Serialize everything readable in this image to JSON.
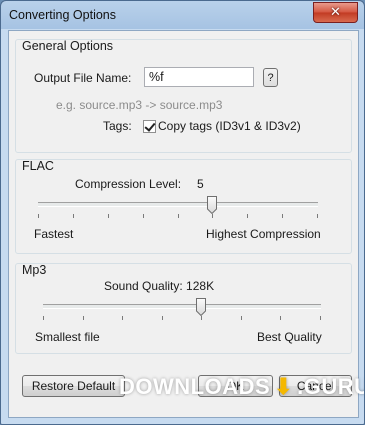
{
  "window": {
    "title": "Converting Options",
    "close_glyph": "✕"
  },
  "general": {
    "title": "General Options",
    "output_label": "Output File Name:",
    "output_value": "%f",
    "help_button": "?",
    "example": "e.g. source.mp3 -> source.mp3",
    "tags_label": "Tags:",
    "copy_tags_label": "Copy tags (ID3v1 & ID3v2)",
    "copy_tags_checked": true
  },
  "flac": {
    "title": "FLAC",
    "compression_label": "Compression Level:",
    "compression_value": "5",
    "slider_min_label": "Fastest",
    "slider_max_label": "Highest Compression",
    "level_fraction": 0.625
  },
  "mp3": {
    "title": "Mp3",
    "quality_label": "Sound Quality: 128K",
    "slider_min_label": "Smallest file",
    "slider_max_label": "Best Quality",
    "level_fraction": 0.571
  },
  "buttons": {
    "restore": "Restore Default",
    "ok": "OK",
    "cancel": "Cancel"
  },
  "watermark": {
    "left": "DOWNLOADS",
    "right": ".GURU"
  },
  "colors": {
    "accent": "#d4553f",
    "watermark_arrow": "#f5b800"
  }
}
